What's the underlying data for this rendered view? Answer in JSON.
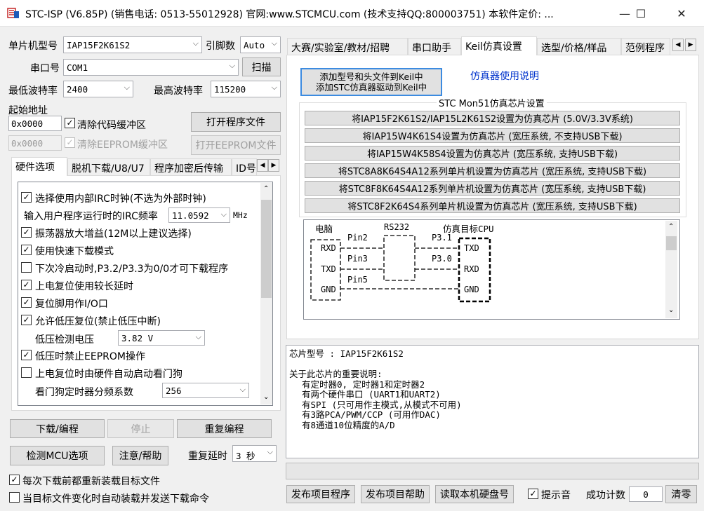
{
  "titlebar": {
    "title": "STC-ISP (V6.85P) (销售电话: 0513-55012928) 官网:www.STCMCU.com (技术支持QQ:800003751) 本软件定价: ...",
    "minimize": "—",
    "maximize": "☐",
    "close": "✕"
  },
  "left": {
    "mcu_label": "单片机型号",
    "mcu_value": "IAP15F2K61S2",
    "pin_label": "引脚数",
    "pin_value": "Auto",
    "port_label": "串口号",
    "port_value": "COM1",
    "scan": "扫描",
    "min_baud_label": "最低波特率",
    "min_baud_value": "2400",
    "max_baud_label": "最高波特率",
    "max_baud_value": "115200",
    "start_addr_label": "起始地址",
    "addr1": "0x0000",
    "clear_code": "清除代码缓冲区",
    "open_prog": "打开程序文件",
    "addr2": "0x0000",
    "clear_eeprom": "清除EEPROM缓冲区",
    "open_eeprom": "打开EEPROM文件",
    "tabs": [
      "硬件选项",
      "脱机下载/U8/U7",
      "程序加密后传输",
      "ID号"
    ],
    "options": {
      "irc": "选择使用内部IRC时钟(不选为外部时钟)",
      "irc_freq_label": "输入用户程序运行时的IRC频率",
      "irc_freq_value": "11.0592",
      "irc_unit": "MHz",
      "osc_gain": "振荡器放大增益(12M以上建议选择)",
      "fast_dl": "使用快速下载模式",
      "cold_boot": "下次冷启动时,P3.2/P3.3为0/0才可下载程序",
      "por_delay": "上电复位使用较长延时",
      "reset_io": "复位脚用作I/O口",
      "lvr": "允许低压复位(禁止低压中断)",
      "lvd_label": "低压检测电压",
      "lvd_value": "3.82 V",
      "lvd_eeprom": "低压时禁止EEPROM操作",
      "wdt_auto": "上电复位时由硬件自动启动看门狗",
      "wdt_div_label": "看门狗定时器分频系数",
      "wdt_div_value": "256"
    },
    "download": "下载/编程",
    "stop": "停止",
    "reprogram": "重复编程",
    "check_mcu": "检测MCU选项",
    "help": "注意/帮助",
    "repeat_delay_label": "重复延时",
    "repeat_delay_value": "3 秒",
    "reload_each": "每次下载前都重新装载目标文件",
    "auto_send": "当目标文件变化时自动装载并发送下载命令"
  },
  "right": {
    "tabs": [
      "大赛/实验室/教材/招聘",
      "串口助手",
      "Keil仿真设置",
      "选型/价格/样品",
      "范例程序"
    ],
    "add_keil_line1": "添加型号和头文件到Keil中",
    "add_keil_line2": "添加STC仿真器驱动到Keil中",
    "sim_manual": "仿真器使用说明",
    "group_title": "STC Mon51仿真芯片设置",
    "sim_buttons": [
      "将IAP15F2K61S2/IAP15L2K61S2设置为仿真芯片 (5.0V/3.3V系统)",
      "将IAP15W4K61S4设置为仿真芯片 (宽压系统, 不支持USB下载)",
      "将IAP15W4K58S4设置为仿真芯片 (宽压系统, 支持USB下载)",
      "将STC8A8K64S4A12系列单片机设置为仿真芯片 (宽压系统, 支持USB下载)",
      "将STC8F8K64S4A12系列单片机设置为仿真芯片 (宽压系统, 支持USB下载)",
      "将STC8F2K64S4系列单片机设置为仿真芯片 (宽压系统, 支持USB下载)"
    ],
    "diagram": {
      "pc": "电脑",
      "rs232": "RS232",
      "target": "仿真目标CPU",
      "rxd": "RXD",
      "txd": "TXD",
      "gnd": "GND",
      "pin2": "Pin2",
      "pin3": "Pin3",
      "pin5": "Pin5",
      "p31": "P3.1",
      "p30": "P3.0",
      "t_txd": "TXD",
      "t_rxd": "RXD",
      "t_gnd": "GND"
    },
    "info": {
      "chip": "芯片型号 : IAP15F2K61S2",
      "note_title": "关于此芯片的重要说明:",
      "notes": [
        "有定时器0, 定时器1和定时器2",
        "有两个硬件串口 (UART1和UART2)",
        "有SPI (只可用作主模式,从模式不可用)",
        "有3路PCA/PWM/CCP (可用作DAC)",
        "有8通道10位精度的A/D"
      ]
    },
    "publish": "发布项目程序",
    "publish_help": "发布项目帮助",
    "read_hdd": "读取本机硬盘号",
    "beep": "提示音",
    "count_label": "成功计数",
    "count_value": "0",
    "clear": "清零"
  }
}
